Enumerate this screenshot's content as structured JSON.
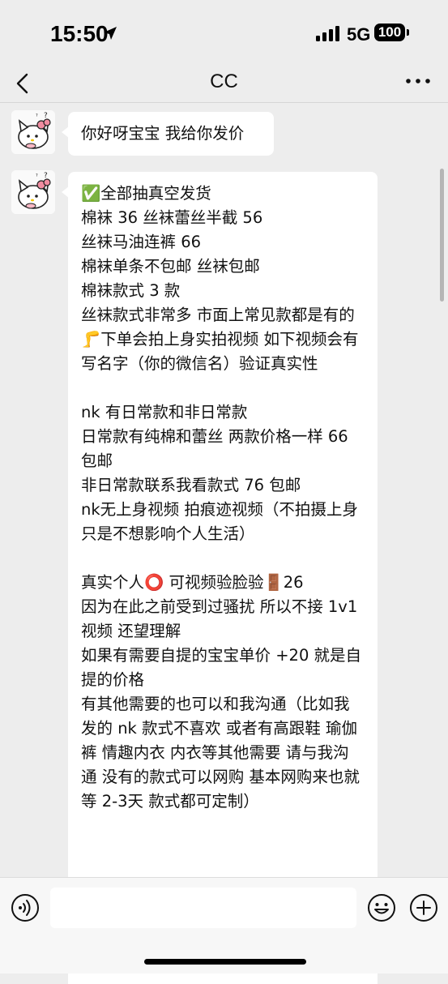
{
  "status_bar": {
    "time": "15:50",
    "network": "5G",
    "battery": "100"
  },
  "nav": {
    "title": "CC"
  },
  "messages": [
    {
      "sender": "CC",
      "text": "你好呀宝宝 我给你发价"
    },
    {
      "sender": "CC",
      "text": "✅全部抽真空发货\n棉袜 36 丝袜蕾丝半截 56\n丝袜马油连裤 66\n棉袜单条不包邮 丝袜包邮\n棉袜款式 3 款\n丝袜款式非常多 市面上常见款都是有的\n🦵下单会拍上身实拍视频 如下视频会有写名字（你的微信名）验证真实性\n\nnk 有日常款和非日常款\n日常款有纯棉和蕾丝 两款价格一样 66 包邮\n非日常款联系我看款式 76 包邮\nnk无上身视频 拍痕迹视频（不拍摄上身只是不想影响个人生活）\n\n真实个人⭕ 可视频验脸验🚪26\n因为在此之前受到过骚扰 所以不接 1v1 视频 还望理解\n如果有需要自提的宝宝单价 +20 就是自提的价格\n有其他需要的也可以和我沟通（比如我发的 nk 款式不喜欢 或者有高跟鞋 瑜伽裤 情趣内衣 内衣等其他需要 请与我沟通 没有的款式可以网购 基本网购来也就等 2-3天 款式都可定制）"
    }
  ],
  "input": {
    "placeholder": ""
  },
  "icons": {
    "back": "chevron-left-icon",
    "more": "more-dots-icon",
    "voice": "voice-icon",
    "emoji": "emoji-icon",
    "plus": "plus-icon"
  }
}
